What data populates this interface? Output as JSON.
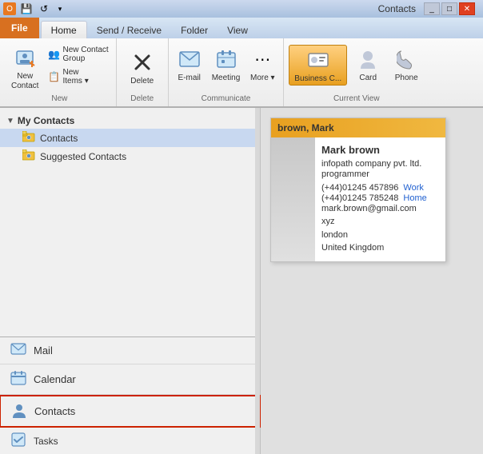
{
  "titleBar": {
    "title": "Contacts"
  },
  "quickAccess": {
    "save": "💾",
    "undo": "↩",
    "dropdown": "▾"
  },
  "ribbon": {
    "tabs": [
      {
        "label": "File",
        "type": "file"
      },
      {
        "label": "Home",
        "type": "normal"
      },
      {
        "label": "Send / Receive",
        "type": "normal"
      },
      {
        "label": "Folder",
        "type": "normal"
      },
      {
        "label": "View",
        "type": "normal"
      }
    ],
    "groups": [
      {
        "name": "new",
        "label": "New",
        "buttons": [
          {
            "label": "New\nContact",
            "icon": "👤",
            "type": "large",
            "id": "new-contact"
          },
          {
            "label": "New Contact\nGroup",
            "icon": "👥",
            "type": "large",
            "id": "new-contact-group"
          },
          {
            "label": "New\nItems",
            "icon": "📋",
            "type": "large-dropdown",
            "id": "new-items"
          }
        ]
      },
      {
        "name": "delete",
        "label": "Delete",
        "buttons": [
          {
            "label": "Delete",
            "icon": "✕",
            "type": "large",
            "id": "delete"
          }
        ]
      },
      {
        "name": "communicate",
        "label": "Communicate",
        "buttons": [
          {
            "label": "E-mail",
            "icon": "✉",
            "type": "large",
            "id": "email"
          },
          {
            "label": "Meeting",
            "icon": "📅",
            "type": "large",
            "id": "meeting"
          },
          {
            "label": "More",
            "icon": "…",
            "type": "large-dropdown",
            "id": "more"
          }
        ]
      },
      {
        "name": "current-view",
        "label": "Current View",
        "buttons": [
          {
            "label": "Business C...",
            "icon": "🪪",
            "type": "large",
            "active": true,
            "id": "business-card"
          },
          {
            "label": "Card",
            "icon": "👤",
            "type": "large",
            "id": "card"
          },
          {
            "label": "Phone",
            "icon": "📞",
            "type": "large",
            "id": "phone"
          }
        ]
      }
    ]
  },
  "sidebar": {
    "treeHeader": "My Contacts",
    "treeItems": [
      {
        "label": "Contacts",
        "icon": "👤",
        "selected": true
      },
      {
        "label": "Suggested Contacts",
        "icon": "👤",
        "selected": false
      }
    ]
  },
  "bottomNav": [
    {
      "label": "Mail",
      "icon": "✉",
      "id": "mail",
      "active": false
    },
    {
      "label": "Calendar",
      "icon": "📅",
      "id": "calendar",
      "active": false
    },
    {
      "label": "Contacts",
      "icon": "👤",
      "id": "contacts",
      "active": true
    },
    {
      "label": "Tasks",
      "icon": "✓",
      "id": "tasks",
      "active": false
    }
  ],
  "contactCard": {
    "headerName": "brown, Mark",
    "name": "Mark brown",
    "company": "infopath company pvt. ltd.",
    "jobTitle": "programmer",
    "phone1": "(+44)01245 457896",
    "phone1Type": "Work",
    "phone2": "(+44)01245 785248",
    "phone2Type": "Home",
    "email": "mark.brown@gmail.com",
    "addressLine1": "xyz",
    "addressLine2": "london",
    "country": "United Kingdom"
  }
}
